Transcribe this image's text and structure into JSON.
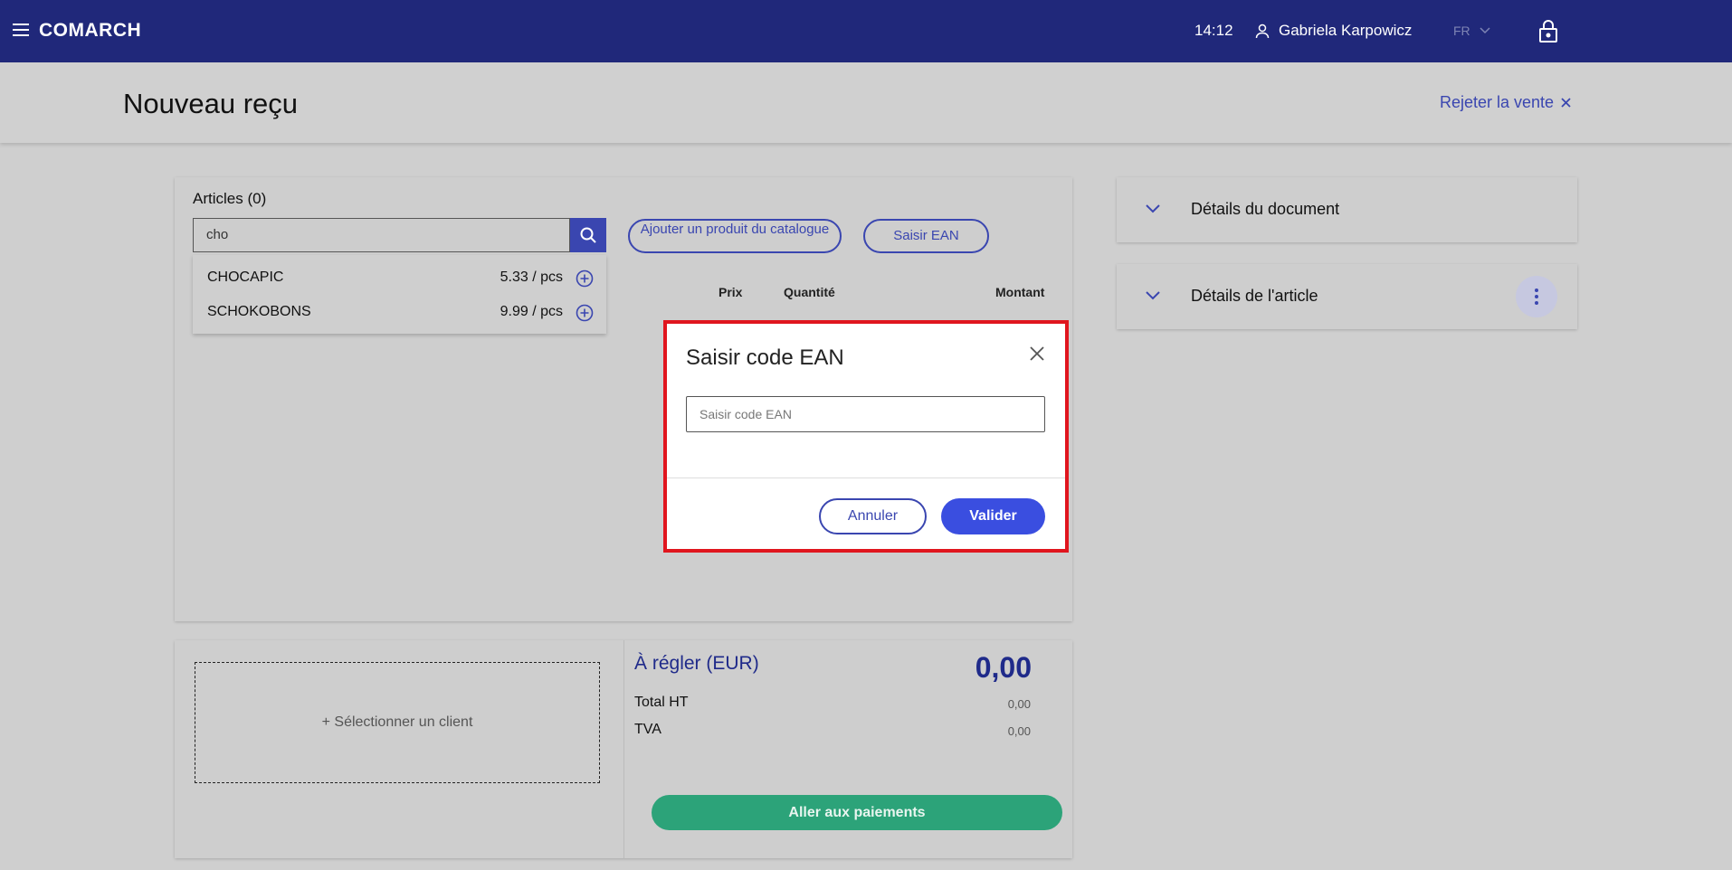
{
  "topbar": {
    "logo": "COMARCH",
    "time": "14:12",
    "user_name": "Gabriela Karpowicz",
    "language": "FR"
  },
  "header": {
    "title": "Nouveau reçu",
    "reject_label": "Rejeter la vente"
  },
  "articles": {
    "title": "Articles (0)",
    "search_value": "cho",
    "results": [
      {
        "name": "CHOCAPIC",
        "price": "5.33 / pcs"
      },
      {
        "name": "SCHOKOBONS",
        "price": "9.99 / pcs"
      }
    ],
    "catalog_button": "Ajouter un produit du catalogue",
    "ean_button": "Saisir EAN",
    "columns": {
      "price": "Prix",
      "quantity": "Quantité",
      "amount": "Montant"
    }
  },
  "totals": {
    "select_client": "+ Sélectionner un client",
    "due_label": "À régler (EUR)",
    "due_value": "0,00",
    "total_ht_label": "Total HT",
    "total_ht_value": "0,00",
    "tva_label": "TVA",
    "tva_value": "0,00",
    "pay_button": "Aller aux paiements"
  },
  "side": {
    "document_details": "Détails du document",
    "article_details": "Détails de l'article"
  },
  "dialog": {
    "title": "Saisir code EAN",
    "input_placeholder": "Saisir code EAN",
    "cancel": "Annuler",
    "confirm": "Valider"
  },
  "colors": {
    "topbar": "#20287a",
    "accent": "#3a46b0",
    "pay": "#2ca379",
    "highlight": "#e0161e"
  }
}
